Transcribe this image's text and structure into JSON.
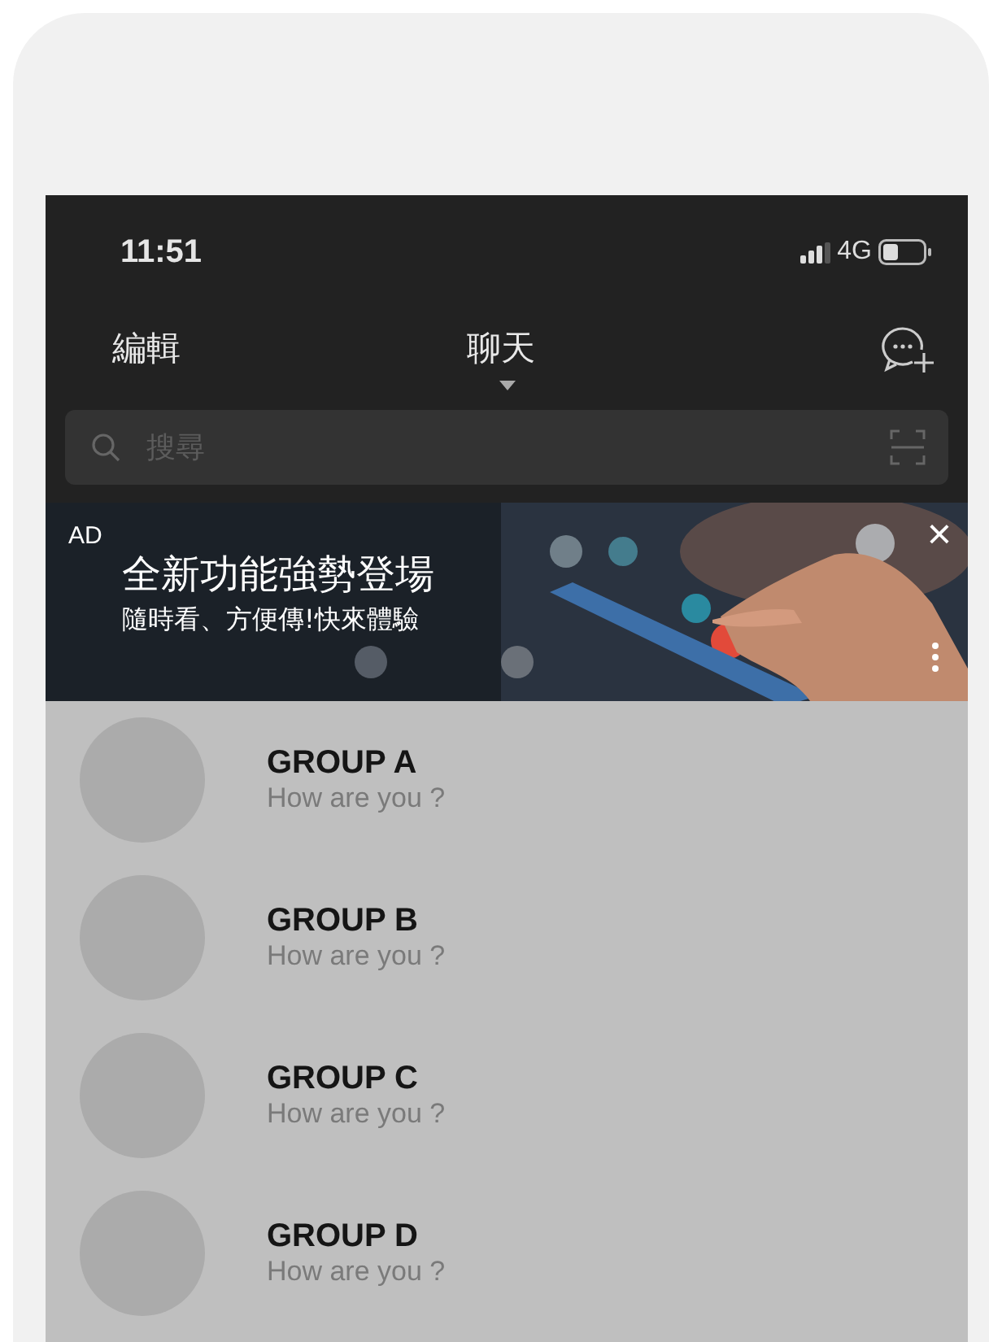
{
  "status_bar": {
    "time": "11:51",
    "network": "4G"
  },
  "nav": {
    "edit": "編輯",
    "title": "聊天"
  },
  "search": {
    "placeholder": "搜尋"
  },
  "ad": {
    "badge": "AD",
    "headline": "全新功能強勢登場",
    "subline": "隨時看、方便傳!快來體驗",
    "close": "×",
    "kind": "picture"
  },
  "chats": [
    {
      "name": "GROUP A",
      "message": "How are you ?"
    },
    {
      "name": "GROUP B",
      "message": "How are you ?"
    },
    {
      "name": "GROUP C",
      "message": "How are you ?"
    },
    {
      "name": "GROUP D",
      "message": "How are you ?"
    }
  ]
}
